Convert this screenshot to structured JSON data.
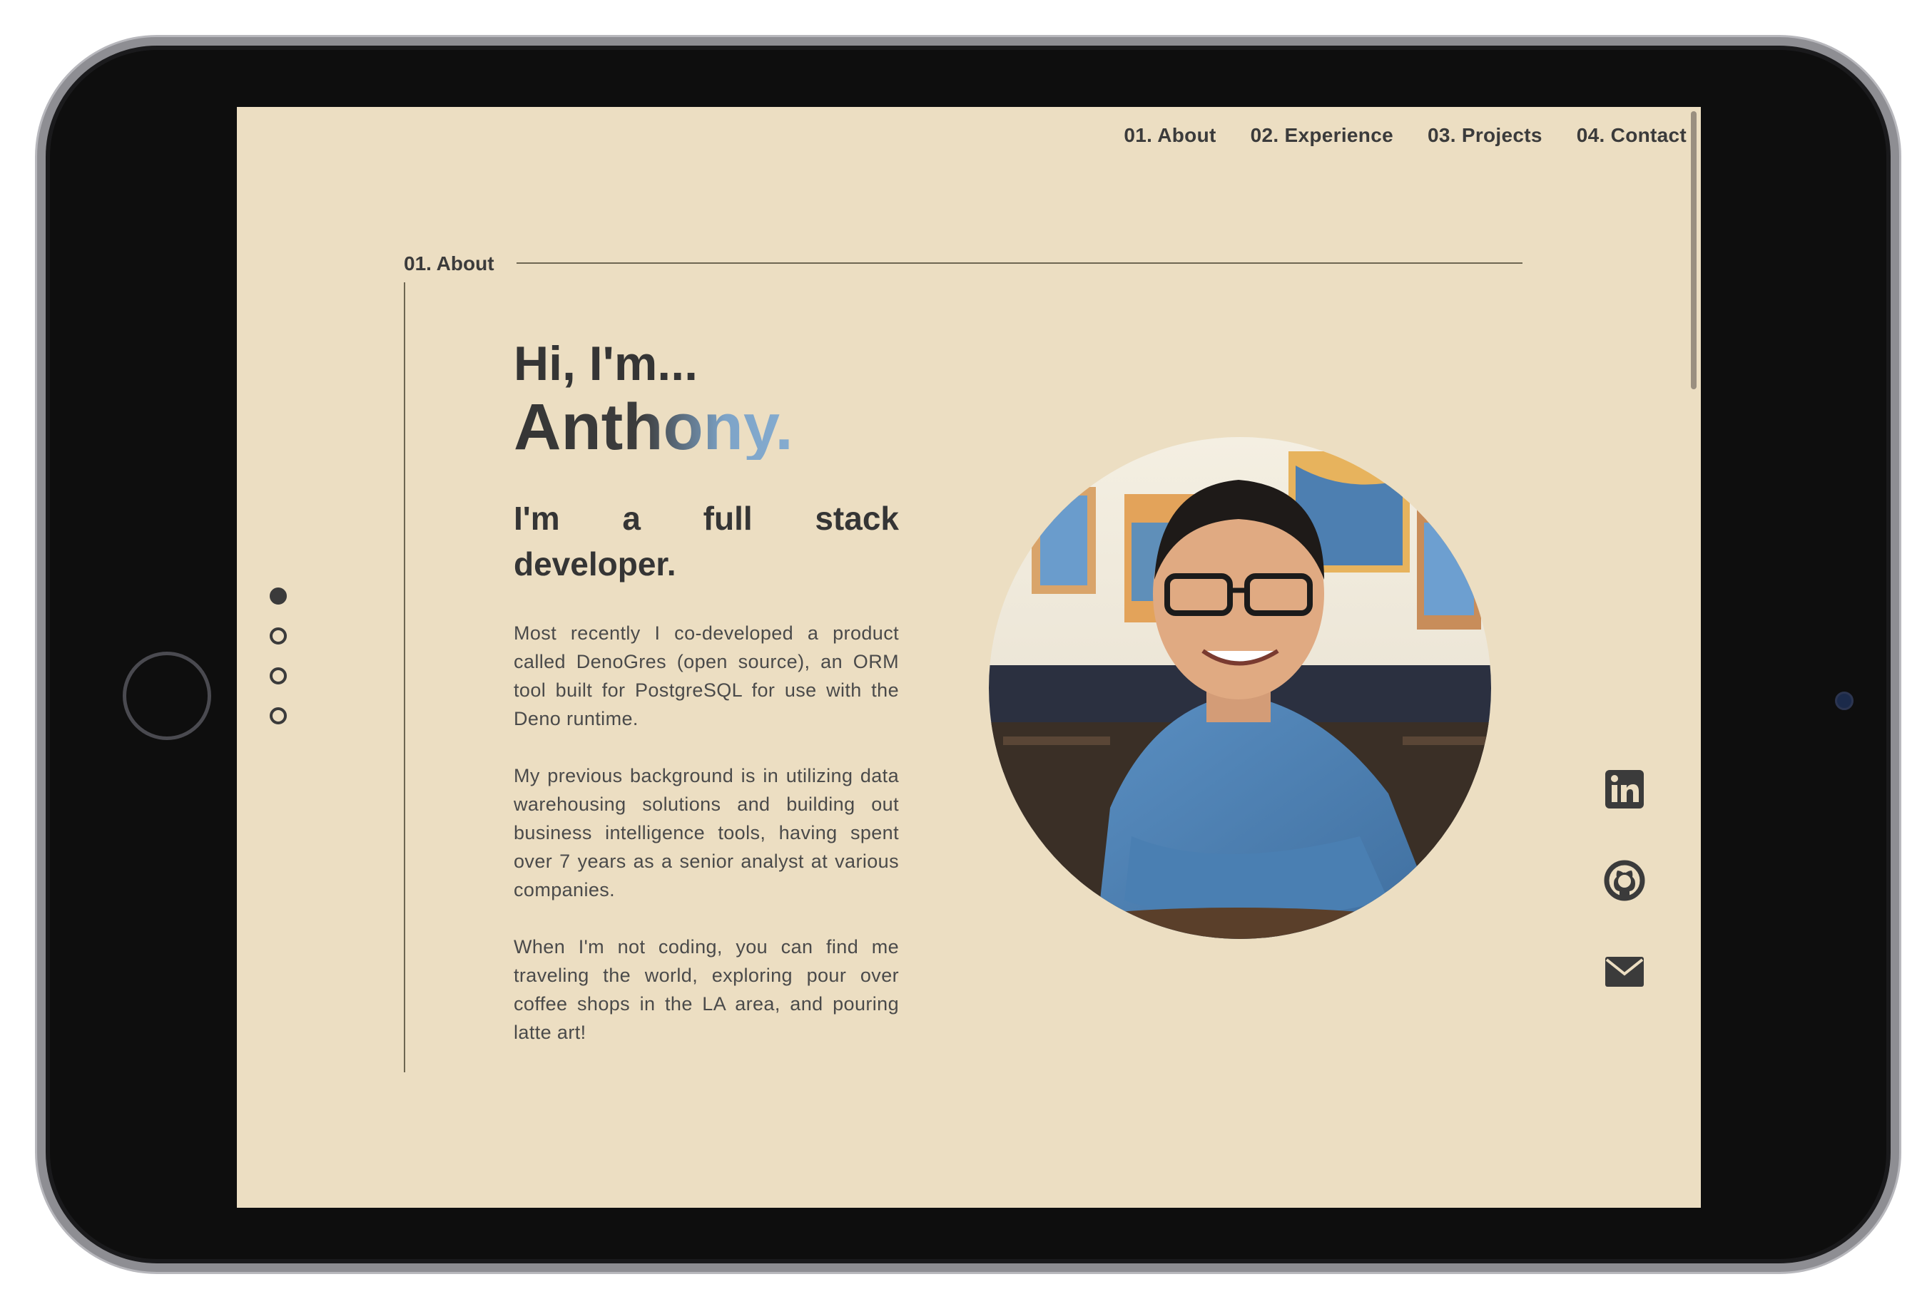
{
  "nav": {
    "items": [
      {
        "label": "01. About"
      },
      {
        "label": "02. Experience"
      },
      {
        "label": "03. Projects"
      },
      {
        "label": "04. Contact"
      }
    ]
  },
  "section": {
    "label": "01. About"
  },
  "hero": {
    "greeting": "Hi, I'm...",
    "name": "Anthony.",
    "role": "I'm a full stack developer.",
    "paragraphs": [
      "Most recently I co-developed a product called DenoGres (open source), an ORM tool built for PostgreSQL for use with the Deno runtime.",
      "My previous background is in utilizing data warehousing solutions and building out business intelligence tools, having spent over 7 years as a senior analyst at various companies.",
      "When I'm not coding, you can find me traveling the world, exploring pour over coffee shops in the LA area, and pouring latte art!"
    ]
  },
  "page_indicator": {
    "count": 4,
    "active_index": 0
  },
  "socials": [
    {
      "icon": "linkedin-icon"
    },
    {
      "icon": "github-icon"
    },
    {
      "icon": "mail-icon"
    }
  ],
  "colors": {
    "background": "#ecdec2",
    "text": "#353535",
    "accent": "#8eb8dc",
    "bezel": "#0e0e0e"
  }
}
